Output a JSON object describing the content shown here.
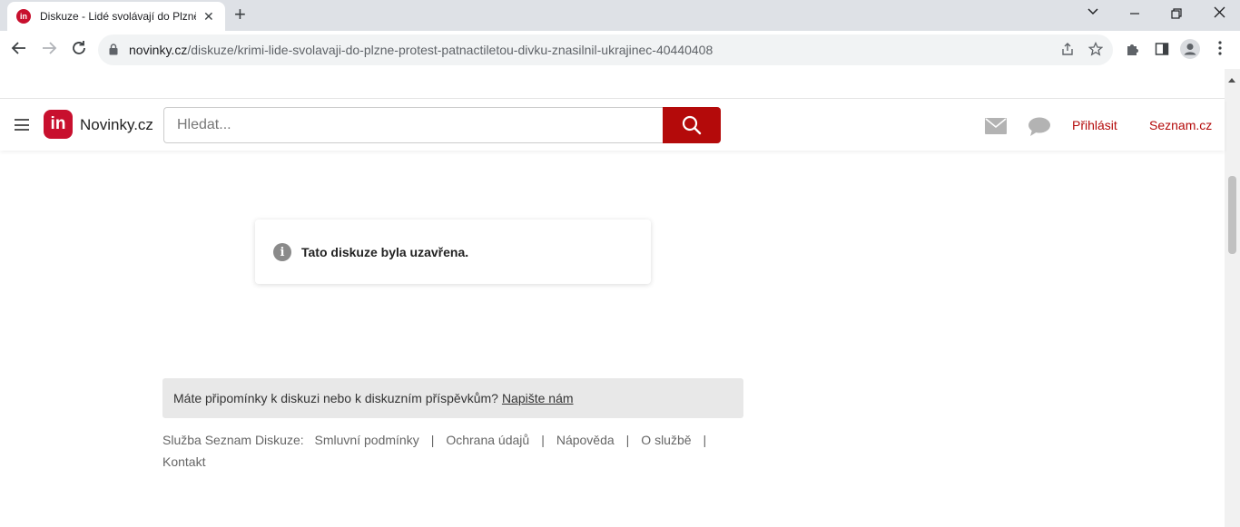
{
  "browser": {
    "tab_title": "Diskuze - Lidé svolávají do Plzně",
    "tab_favicon": "in",
    "url_host": "novinky.cz",
    "url_path": "/diskuze/krimi-lide-svolavaji-do-plzne-protest-patnactiletou-divku-znasilnil-ukrajinec-40440408"
  },
  "header": {
    "logo_mark": "in",
    "logo_text": "Novinky.cz",
    "search_placeholder": "Hledat...",
    "login_label": "Přihlásit",
    "seznam_label": "Seznam.cz"
  },
  "notice": {
    "text": "Tato diskuze byla uzavřena."
  },
  "feedback": {
    "text": "Máte připomínky k diskuzi nebo k diskuzním příspěvkům?",
    "link": "Napište nám"
  },
  "footer": {
    "service_label": "Služba Seznam Diskuze:",
    "links": [
      "Smluvní podmínky",
      "Ochrana údajů",
      "Nápověda",
      "O službě",
      "Kontakt"
    ]
  },
  "colors": {
    "brand": "#c8102e",
    "search_button": "#b40a0a",
    "link_red": "#b40a0a"
  }
}
